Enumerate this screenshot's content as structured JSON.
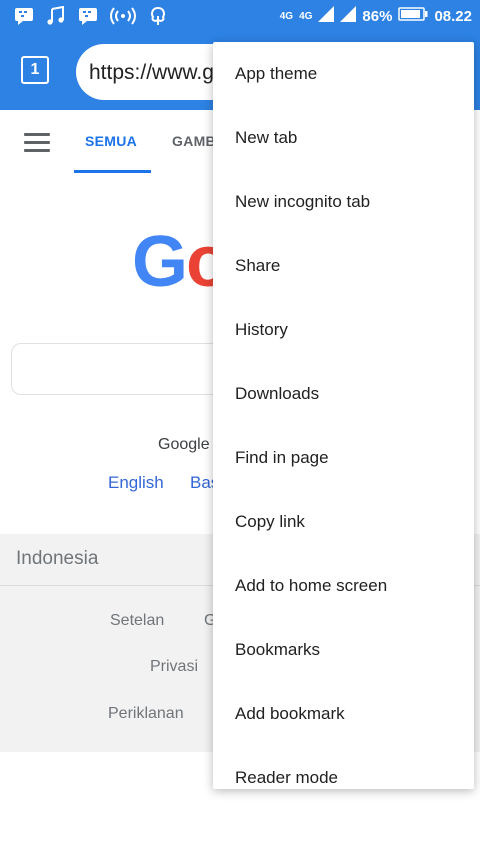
{
  "status_bar": {
    "left_icons": [
      "bbm-icon",
      "music-icon",
      "bbm-icon",
      "wifi-hotspot-icon",
      "tree-icon"
    ],
    "network_label": "4G",
    "network_label_2": "4G",
    "battery_percent": "86%",
    "time": "08.22"
  },
  "toolbar": {
    "tab_count": "1",
    "url": "https://www.g"
  },
  "page": {
    "tabs": [
      "SEMUA",
      "GAMB"
    ],
    "logo_letters": [
      "G",
      "o"
    ],
    "offered_text": "Google",
    "languages": [
      "English",
      "Bas"
    ],
    "country": "Indonesia",
    "footer_links": [
      "Setelan",
      "G",
      "Privasi",
      "Periklanan"
    ]
  },
  "menu": {
    "items": [
      "App theme",
      "New tab",
      "New incognito tab",
      "Share",
      "History",
      "Downloads",
      "Find in page",
      "Copy link",
      "Add to home screen",
      "Bookmarks",
      "Add bookmark",
      "Reader mode"
    ]
  },
  "colors": {
    "toolbar_blue": "#2d82e3",
    "google_blue": "#4285f4",
    "google_red": "#ea4335",
    "link_blue": "#3367d6"
  }
}
